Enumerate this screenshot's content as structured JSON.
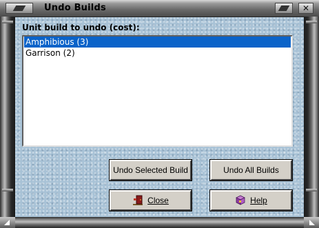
{
  "window": {
    "title": "Undo Builds"
  },
  "list": {
    "label": "Unit build to undo (cost):",
    "items": [
      {
        "label": "Amphibious (3)",
        "selected": true
      },
      {
        "label": "Garrison (2)",
        "selected": false
      }
    ]
  },
  "buttons": {
    "undo_selected": "Undo Selected Build",
    "undo_all": "Undo All Builds",
    "close": "Close",
    "help": "Help"
  },
  "icons": {
    "close": "exit-door-icon",
    "help": "help-book-icon",
    "system": "system-menu-icon",
    "window_close": "close-icon"
  },
  "colors": {
    "selection": "#0a63c9",
    "content_background": "#a8c2d6",
    "button_face": "#d4d0c8"
  }
}
